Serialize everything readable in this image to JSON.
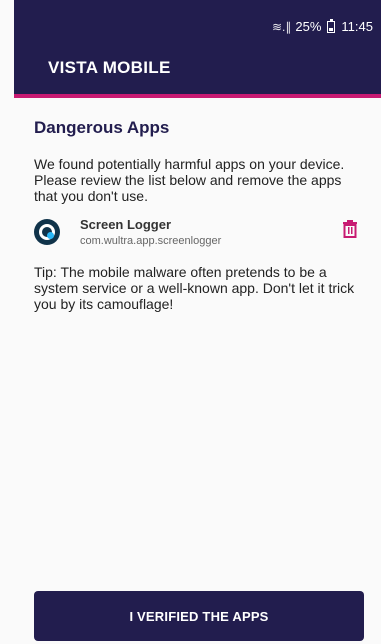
{
  "statusbar": {
    "signal": "≋.∥",
    "battery": "25%",
    "time": "11:45"
  },
  "appbar": {
    "title": "VISTA MOBILE"
  },
  "section": {
    "title": "Dangerous Apps",
    "description": "We found potentially harmful apps on your device. Please review the list below and remove the apps that you don't use."
  },
  "apps": [
    {
      "name": "Screen Logger",
      "package": "com.wultra.app.screenlogger",
      "icon": "screen-logger-app-icon"
    }
  ],
  "tip": "Tip: The mobile malware often pretends to be a system service or a well-known app. Don't let it trick you by its camouflage!",
  "actions": {
    "verify_label": "I VERIFIED THE APPS"
  },
  "colors": {
    "primary": "#221d4e",
    "accent": "#c81a72",
    "delete": "#c81a72"
  }
}
